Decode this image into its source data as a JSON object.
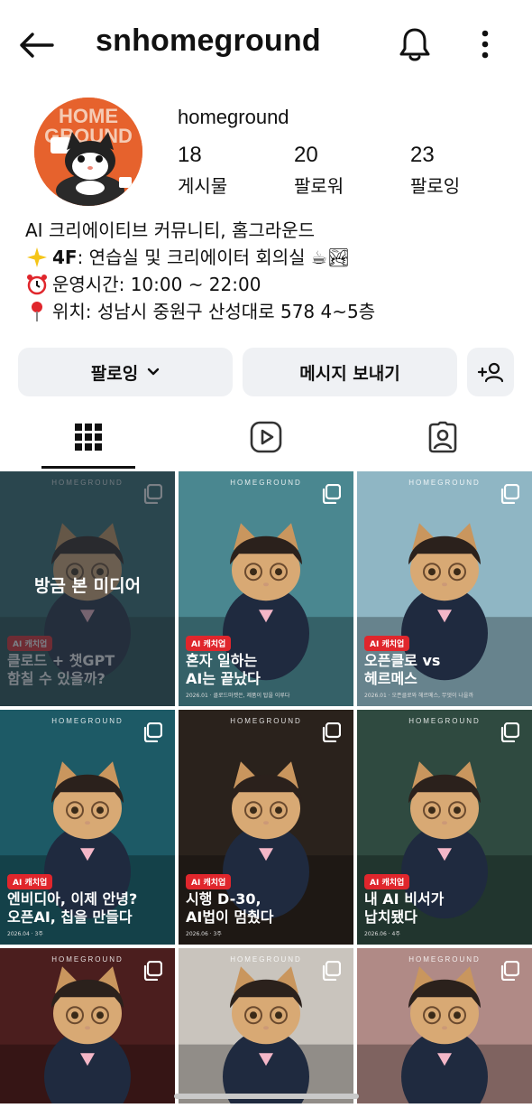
{
  "header": {
    "title": "snhomeground",
    "back_icon": "arrow-left-icon",
    "bell_icon": "bell-icon",
    "more_icon": "more-vertical-icon"
  },
  "profile": {
    "avatar_text": "HOMEGROUND",
    "name": "homeground",
    "stats": [
      {
        "value": "18",
        "label": "게시물"
      },
      {
        "value": "20",
        "label": "팔로워"
      },
      {
        "value": "23",
        "label": "팔로잉"
      }
    ],
    "bio": [
      {
        "icon": "",
        "text": "AI 크리에이티브 커뮤니티, 홈그라운드"
      },
      {
        "icon": "sparkle-star-icon",
        "bold": "4F",
        "text": ": 연습실 및 크리에이터 회의실 ☕🏞"
      },
      {
        "icon": "alarm-clock-icon",
        "text": "운영시간: 10:00 ~ 22:00"
      },
      {
        "icon": "pin-icon",
        "text": "위치: 성남시 중원구 산성대로 578 4~5층"
      }
    ]
  },
  "actions": {
    "following_label": "팔로잉",
    "message_label": "메시지 보내기",
    "add_person_icon": "add-person-icon"
  },
  "tabs": [
    {
      "icon": "grid-icon",
      "active": true
    },
    {
      "icon": "reels-icon",
      "active": false
    },
    {
      "icon": "tagged-icon",
      "active": false
    }
  ],
  "posts": [
    {
      "brand": "HOMEGROUND",
      "badge": "AI 캐치업",
      "headline": "클로드 + 챗GPT\n함칠 수 있을까?",
      "sub": "",
      "overlay": "방금 본 미디어",
      "bg": "#2f6b70"
    },
    {
      "brand": "HOMEGROUND",
      "badge": "AI 캐치업",
      "headline": "혼자 일하는\nAI는 끝났다",
      "sub": "2026.01 · 클로드마켓은, 제품이 탑을 이루다",
      "overlay": "",
      "bg": "#4a8790"
    },
    {
      "brand": "HOMEGROUND",
      "badge": "AI 캐치업",
      "headline": "오픈클로 vs\n헤르메스",
      "sub": "2026.01 · 오픈클로와 헤르메스, 무엇이 나을까",
      "overlay": "",
      "bg": "#8fb6c4"
    },
    {
      "brand": "HOMEGROUND",
      "badge": "AI 캐치업",
      "headline": "엔비디아, 이제 안녕?\n오픈AI, 칩을 만들다",
      "sub": "2026.04 · 3주",
      "overlay": "",
      "bg": "#1d5a66"
    },
    {
      "brand": "HOMEGROUND",
      "badge": "AI 캐치업",
      "headline": "시행 D-30,\nAI법이 멈췄다",
      "sub": "2026.06 · 3주",
      "overlay": "",
      "bg": "#2a221c"
    },
    {
      "brand": "HOMEGROUND",
      "badge": "AI 캐치업",
      "headline": "내 AI 비서가\n납치됐다",
      "sub": "2026.06 · 4주",
      "overlay": "",
      "bg": "#2f4a40"
    },
    {
      "brand": "HOMEGROUND",
      "badge": "",
      "headline": "",
      "sub": "",
      "overlay": "",
      "bg": "#4b1e1e"
    },
    {
      "brand": "HOMEGROUND",
      "badge": "",
      "headline": "",
      "sub": "",
      "overlay": "",
      "bg": "#c9c4bd"
    },
    {
      "brand": "HOMEGROUND",
      "badge": "",
      "headline": "",
      "sub": "",
      "overlay": "",
      "bg": "#b08a86"
    }
  ]
}
